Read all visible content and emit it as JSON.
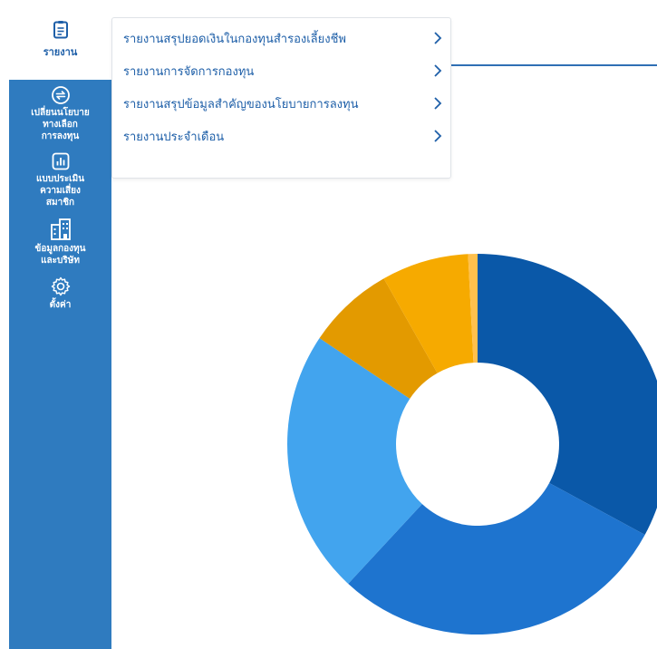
{
  "sidebar": {
    "top_item": {
      "label": "รายงาน",
      "icon": "report-document-icon"
    },
    "items": [
      {
        "label": "เปลี่ยนนโยบาย\nทางเลือก\nการลงทุน",
        "icon": "switch-arrows-icon"
      },
      {
        "label": "แบบประเมิน\nความเสี่ยง\nสมาชิก",
        "icon": "bar-chart-icon"
      },
      {
        "label": "ข้อมูลกองทุน\nและบริษัท",
        "icon": "building-icon"
      },
      {
        "label": "ตั้งค่า",
        "icon": "gear-icon"
      }
    ],
    "colors": {
      "background": "#2f7bbf",
      "top_label": "#1e5fa8"
    }
  },
  "dropdown": {
    "items": [
      {
        "label": "รายงานสรุปยอดเงินในกองทุนสำรองเลี้ยงชีพ"
      },
      {
        "label": "รายงานการจัดการกองทุน"
      },
      {
        "label": "รายงานสรุปข้อมูลสำคัญของนโยบายการลงทุน"
      },
      {
        "label": "รายงานประจำเดือน"
      }
    ],
    "arrow_icon": "chevron-right-icon",
    "text_color": "#1e5fa8"
  },
  "chart_data": {
    "type": "pie",
    "title": "",
    "donut": true,
    "values": [
      32.9,
      29.0,
      22.5,
      7.4,
      7.4,
      0.8
    ],
    "colors": [
      "#0a58a8",
      "#1e74cf",
      "#42a4ee",
      "#e39a00",
      "#f6aa00",
      "#ffc04d"
    ]
  }
}
